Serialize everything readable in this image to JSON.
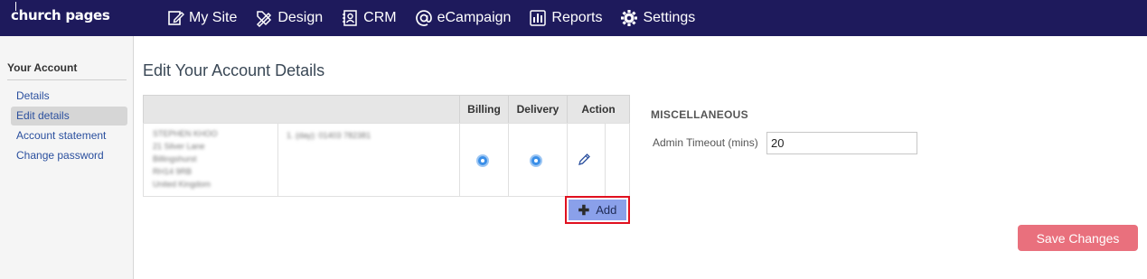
{
  "brand": {
    "logo_text": "church pages"
  },
  "nav": {
    "items": [
      {
        "label": "My Site",
        "icon": "edit-page-icon"
      },
      {
        "label": "Design",
        "icon": "design-tools-icon"
      },
      {
        "label": "CRM",
        "icon": "contacts-icon"
      },
      {
        "label": "eCampaign",
        "icon": "at-sign-icon"
      },
      {
        "label": "Reports",
        "icon": "bar-chart-icon"
      },
      {
        "label": "Settings",
        "icon": "gear-icon"
      }
    ]
  },
  "sidebar": {
    "title": "Your Account",
    "items": [
      {
        "label": "Details",
        "active": false
      },
      {
        "label": "Edit details",
        "active": true
      },
      {
        "label": "Account statement",
        "active": false
      },
      {
        "label": "Change password",
        "active": false
      }
    ]
  },
  "main": {
    "title": "Edit Your Account Details",
    "table": {
      "headers": {
        "billing": "Billing",
        "delivery": "Delivery",
        "action": "Action"
      },
      "rows": [
        {
          "address_blurred": "STEPHEN KHOO\n21 Silver Lane\nBillingshurst\nRH14 9RB\nUnited Kingdom",
          "phone_blurred": "1. (day): 01403 782381",
          "billing_selected": true,
          "delivery_selected": true
        }
      ]
    },
    "add_button_label": "Add",
    "misc": {
      "heading": "MISCELLANEOUS",
      "admin_timeout_label": "Admin Timeout (mins)",
      "admin_timeout_value": "20"
    },
    "save_button_label": "Save Changes"
  },
  "colors": {
    "topbar": "#1e1a5c",
    "link": "#2a4f9e",
    "add_button": "#8aa0ea",
    "highlight_border": "#e0101f",
    "save_button": "#e9707d",
    "radio": "#3b8fe8"
  }
}
